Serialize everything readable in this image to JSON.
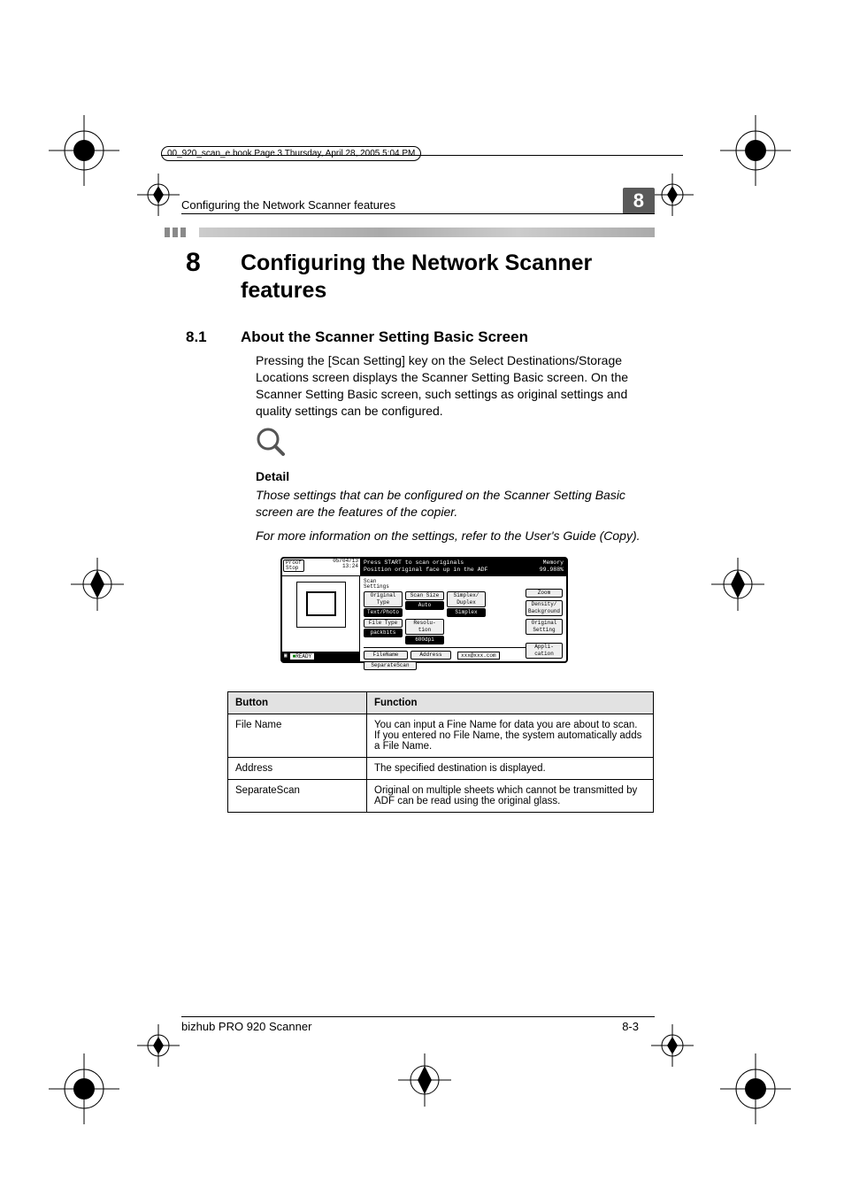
{
  "book_header": "00_920_scan_e.book  Page 3  Thursday, April 28, 2005  5:04 PM",
  "running_head": "Configuring the Network Scanner features",
  "chapter_badge": "8",
  "chapter_number": "8",
  "chapter_title": "Configuring the Network Scanner features",
  "section_number": "8.1",
  "section_title": "About the Scanner Setting Basic Screen",
  "paragraph": "Pressing the [Scan Setting] key on the Select Destinations/Storage Locations screen displays the Scanner Setting Basic screen. On the Scanner Setting Basic screen, such settings as original settings and quality settings can be configured.",
  "detail_heading": "Detail",
  "detail_p1": "Those settings that can be configured on the Scanner Setting Basic screen are the features of the copier.",
  "detail_p2": "For more information on the settings, refer to the User's Guide (Copy).",
  "panel": {
    "proof": "Proof\nStop",
    "date": "05/04/13",
    "time": "13:24",
    "msg_line1": "Press START to scan originals",
    "msg_line2": "Position original face up in the ADF",
    "memory_label": "Memory",
    "memory_value": "99.988%",
    "ready": "READY",
    "scan_settings": "Scan\nSettings",
    "original_type": "Original\nType",
    "text_photo": "Text/Photo",
    "scan_size": "Scan Size",
    "auto": "Auto",
    "simplex_duplex": "Simplex/\nDuplex",
    "simplex": "Simplex",
    "file_type": "File Type",
    "packbits": "packbits",
    "resolution": "Resolu-\ntion",
    "res_value": "600dpi",
    "zoom": "Zoom",
    "density": "Density/\nBackground",
    "original_setting": "Original\nSetting",
    "application": "Appli-\ncation",
    "filename": "FileName",
    "address": "Address",
    "address_value": "xxx@xxx.com",
    "separate_scan": "SeparateScan"
  },
  "table": {
    "head_button": "Button",
    "head_function": "Function",
    "rows": [
      {
        "button": "File Name",
        "function": "You can input a Fine Name for data you are about to scan. If you entered no File Name, the system automatically adds a File Name."
      },
      {
        "button": "Address",
        "function": "The specified destination is displayed."
      },
      {
        "button": "SeparateScan",
        "function": "Original on multiple sheets which cannot be transmitted by ADF can be read using the original glass."
      }
    ]
  },
  "footer_left": "bizhub PRO 920 Scanner",
  "footer_right": "8-3"
}
